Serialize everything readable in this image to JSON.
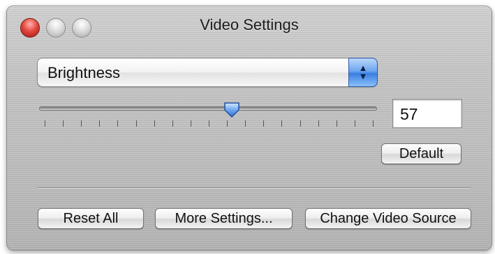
{
  "window": {
    "title": "Video Settings"
  },
  "popup": {
    "selected": "Brightness"
  },
  "slider": {
    "value": 57,
    "min": 0,
    "max": 100,
    "value_fraction": 0.57
  },
  "value_field": {
    "value": "57"
  },
  "buttons": {
    "default": "Default",
    "reset_all": "Reset All",
    "more_settings": "More Settings...",
    "change_video_source": "Change Video Source"
  },
  "colors": {
    "accent": "#3a7fe0",
    "close": "#e5493f"
  }
}
